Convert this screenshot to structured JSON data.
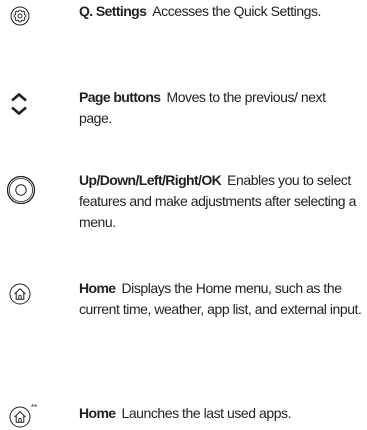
{
  "items": [
    {
      "icon": "q-settings-gear-icon",
      "term": "Q. Settings",
      "desc": "Accesses the Quick Settings."
    },
    {
      "icon": "page-up-down-chevrons-icon",
      "term": "Page buttons",
      "desc": "Moves to the previous/ next page."
    },
    {
      "icon": "navigation-ring-ok-icon",
      "term": "Up/Down/Left/Right/OK",
      "desc": "Enables you to select features and make adjustments after selecting a menu."
    },
    {
      "icon": "home-button-icon",
      "term": "Home",
      "desc": "Displays the Home menu, such as the current time, weather, app list, and external input."
    },
    {
      "icon": "home-button-long-press-icon",
      "icon_superscript": "**",
      "term": "Home",
      "desc": "Launches the last used apps."
    }
  ],
  "colors": {
    "text": "#231f20",
    "icon_stroke": "#231f20"
  }
}
